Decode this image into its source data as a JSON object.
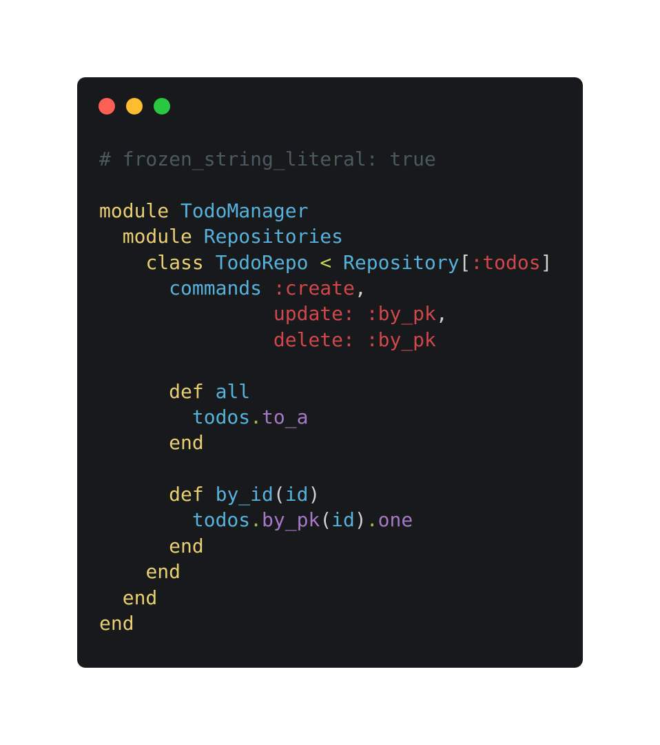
{
  "window": {
    "traffic_lights": {
      "close_color": "#ff5f57",
      "minimize_color": "#febc2e",
      "zoom_color": "#28c840"
    }
  },
  "editor": {
    "language": "ruby",
    "lines": [
      [
        {
          "t": "# frozen_string_literal: true",
          "k": "comment"
        }
      ],
      [],
      [
        {
          "t": "module",
          "k": "keyword"
        },
        {
          "t": " ",
          "k": "punct"
        },
        {
          "t": "TodoManager",
          "k": "const"
        }
      ],
      [
        {
          "t": "  ",
          "k": "punct"
        },
        {
          "t": "module",
          "k": "keyword"
        },
        {
          "t": " ",
          "k": "punct"
        },
        {
          "t": "Repositories",
          "k": "const"
        }
      ],
      [
        {
          "t": "    ",
          "k": "punct"
        },
        {
          "t": "class",
          "k": "keyword"
        },
        {
          "t": " ",
          "k": "punct"
        },
        {
          "t": "TodoRepo",
          "k": "const"
        },
        {
          "t": " ",
          "k": "punct"
        },
        {
          "t": "<",
          "k": "op"
        },
        {
          "t": " ",
          "k": "punct"
        },
        {
          "t": "Repository",
          "k": "const"
        },
        {
          "t": "[",
          "k": "punct"
        },
        {
          "t": ":todos",
          "k": "symbol"
        },
        {
          "t": "]",
          "k": "punct"
        }
      ],
      [
        {
          "t": "      ",
          "k": "punct"
        },
        {
          "t": "commands",
          "k": "ident"
        },
        {
          "t": " ",
          "k": "punct"
        },
        {
          "t": ":create",
          "k": "symbol"
        },
        {
          "t": ",",
          "k": "punct"
        }
      ],
      [
        {
          "t": "               ",
          "k": "punct"
        },
        {
          "t": "update:",
          "k": "symbol"
        },
        {
          "t": " ",
          "k": "punct"
        },
        {
          "t": ":by_pk",
          "k": "symbol"
        },
        {
          "t": ",",
          "k": "punct"
        }
      ],
      [
        {
          "t": "               ",
          "k": "punct"
        },
        {
          "t": "delete:",
          "k": "symbol"
        },
        {
          "t": " ",
          "k": "punct"
        },
        {
          "t": ":by_pk",
          "k": "symbol"
        }
      ],
      [],
      [
        {
          "t": "      ",
          "k": "punct"
        },
        {
          "t": "def",
          "k": "keyword"
        },
        {
          "t": " ",
          "k": "punct"
        },
        {
          "t": "all",
          "k": "ident"
        }
      ],
      [
        {
          "t": "        ",
          "k": "punct"
        },
        {
          "t": "todos",
          "k": "ident"
        },
        {
          "t": ".",
          "k": "dot"
        },
        {
          "t": "to_a",
          "k": "method"
        }
      ],
      [
        {
          "t": "      ",
          "k": "punct"
        },
        {
          "t": "end",
          "k": "keyword"
        }
      ],
      [],
      [
        {
          "t": "      ",
          "k": "punct"
        },
        {
          "t": "def",
          "k": "keyword"
        },
        {
          "t": " ",
          "k": "punct"
        },
        {
          "t": "by_id",
          "k": "ident"
        },
        {
          "t": "(",
          "k": "punct"
        },
        {
          "t": "id",
          "k": "ident"
        },
        {
          "t": ")",
          "k": "punct"
        }
      ],
      [
        {
          "t": "        ",
          "k": "punct"
        },
        {
          "t": "todos",
          "k": "ident"
        },
        {
          "t": ".",
          "k": "dot"
        },
        {
          "t": "by_pk",
          "k": "method"
        },
        {
          "t": "(",
          "k": "punct"
        },
        {
          "t": "id",
          "k": "ident"
        },
        {
          "t": ")",
          "k": "punct"
        },
        {
          "t": ".",
          "k": "dot"
        },
        {
          "t": "one",
          "k": "method"
        }
      ],
      [
        {
          "t": "      ",
          "k": "punct"
        },
        {
          "t": "end",
          "k": "keyword"
        }
      ],
      [
        {
          "t": "    ",
          "k": "punct"
        },
        {
          "t": "end",
          "k": "keyword"
        }
      ],
      [
        {
          "t": "  ",
          "k": "punct"
        },
        {
          "t": "end",
          "k": "keyword"
        }
      ],
      [
        {
          "t": "end",
          "k": "keyword"
        }
      ]
    ]
  }
}
